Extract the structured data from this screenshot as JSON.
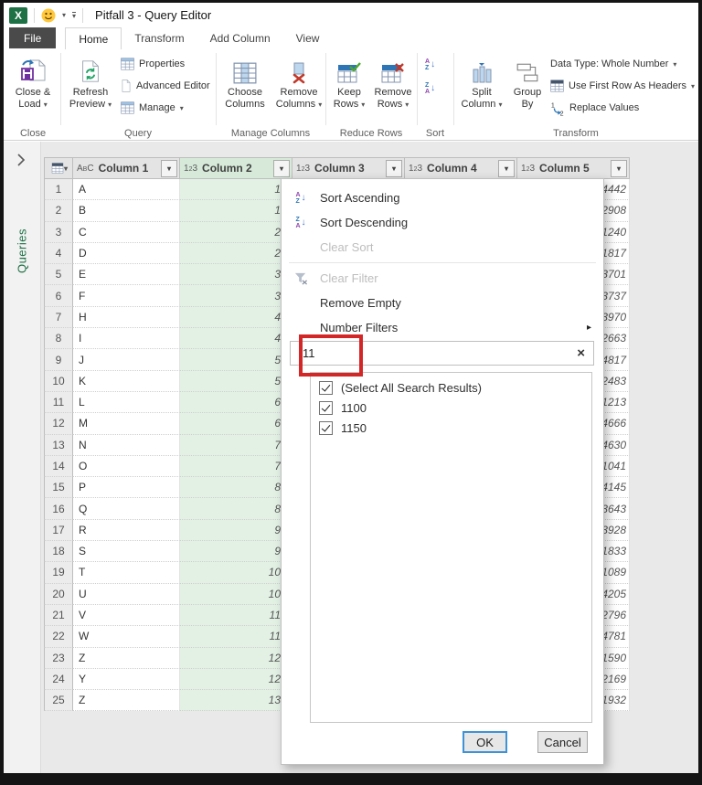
{
  "window": {
    "title": "Pitfall 3 - Query Editor"
  },
  "icons": {
    "dropdown": "▾",
    "submenu": "▸",
    "clear": "×",
    "chevron_right": ">",
    "sort_a": "A",
    "sort_z": "Z",
    "sort_arrow": "↓",
    "replace_one": "1",
    "replace_two": "2",
    "type_text": {
      "a": "A",
      "b": "B",
      "c": "C"
    },
    "type_num": {
      "a": "1",
      "b": "2",
      "c": "3"
    }
  },
  "tabs": {
    "file": "File",
    "home": "Home",
    "transform": "Transform",
    "add_column": "Add Column",
    "view": "View"
  },
  "ribbon": {
    "close_load_line1": "Close &",
    "close_load_line2": "Load",
    "refresh_line1": "Refresh",
    "refresh_line2": "Preview",
    "properties": "Properties",
    "advanced_editor": "Advanced Editor",
    "manage": "Manage",
    "choose_line1": "Choose",
    "choose_line2": "Columns",
    "remove_cols_line1": "Remove",
    "remove_cols_line2": "Columns",
    "keep_line1": "Keep",
    "keep_line2": "Rows",
    "remove_rows_line1": "Remove",
    "remove_rows_line2": "Rows",
    "split_line1": "Split",
    "split_line2": "Column",
    "group_line1": "Group",
    "group_line2": "By",
    "data_type": "Data Type: Whole Number",
    "first_row": "Use First Row As Headers",
    "replace_values": "Replace Values",
    "labels": {
      "close": "Close",
      "query": "Query",
      "manage_columns": "Manage Columns",
      "reduce_rows": "Reduce Rows",
      "sort": "Sort",
      "transform": "Transform"
    }
  },
  "sidebar": {
    "queries": "Queries"
  },
  "table": {
    "columns": [
      {
        "name": "Column 1",
        "type": "text"
      },
      {
        "name": "Column 2",
        "type": "number",
        "selected": true
      },
      {
        "name": "Column 3",
        "type": "number"
      },
      {
        "name": "Column 4",
        "type": "number"
      },
      {
        "name": "Column 5",
        "type": "number"
      }
    ],
    "rows": [
      {
        "n": "1",
        "letter": "A",
        "col2": "1",
        "col5": "4442"
      },
      {
        "n": "2",
        "letter": "B",
        "col2": "1",
        "col5": "2908"
      },
      {
        "n": "3",
        "letter": "C",
        "col2": "2",
        "col5": "1240"
      },
      {
        "n": "4",
        "letter": "D",
        "col2": "2",
        "col5": "1817"
      },
      {
        "n": "5",
        "letter": "E",
        "col2": "3",
        "col5": "3701"
      },
      {
        "n": "6",
        "letter": "F",
        "col2": "3",
        "col5": "3737"
      },
      {
        "n": "7",
        "letter": "H",
        "col2": "4",
        "col5": "3970"
      },
      {
        "n": "8",
        "letter": "I",
        "col2": "4",
        "col5": "2663"
      },
      {
        "n": "9",
        "letter": "J",
        "col2": "5",
        "col5": "4817"
      },
      {
        "n": "10",
        "letter": "K",
        "col2": "5",
        "col5": "2483"
      },
      {
        "n": "11",
        "letter": "L",
        "col2": "6",
        "col5": "1213"
      },
      {
        "n": "12",
        "letter": "M",
        "col2": "6",
        "col5": "4666"
      },
      {
        "n": "13",
        "letter": "N",
        "col2": "7",
        "col5": "4630"
      },
      {
        "n": "14",
        "letter": "O",
        "col2": "7",
        "col5": "1041"
      },
      {
        "n": "15",
        "letter": "P",
        "col2": "8",
        "col5": "4145"
      },
      {
        "n": "16",
        "letter": "Q",
        "col2": "8",
        "col5": "3643"
      },
      {
        "n": "17",
        "letter": "R",
        "col2": "9",
        "col5": "3928"
      },
      {
        "n": "18",
        "letter": "S",
        "col2": "9",
        "col5": "1833"
      },
      {
        "n": "19",
        "letter": "T",
        "col2": "10",
        "col5": "1089"
      },
      {
        "n": "20",
        "letter": "U",
        "col2": "10",
        "col5": "4205"
      },
      {
        "n": "21",
        "letter": "V",
        "col2": "11",
        "col5": "2796"
      },
      {
        "n": "22",
        "letter": "W",
        "col2": "11",
        "col5": "4781"
      },
      {
        "n": "23",
        "letter": "Z",
        "col2": "12",
        "col5": "1590"
      },
      {
        "n": "24",
        "letter": "Y",
        "col2": "12",
        "col5": "2169"
      },
      {
        "n": "25",
        "letter": "Z",
        "col2": "13",
        "col5": "1932"
      }
    ]
  },
  "filter_menu": {
    "items": [
      {
        "label": "Sort Ascending"
      },
      {
        "label": "Sort Descending"
      },
      {
        "label": "Clear Sort",
        "disabled": true
      },
      {
        "label": "Clear Filter",
        "disabled": true
      },
      {
        "label": "Remove Empty"
      },
      {
        "label": "Number Filters",
        "submenu": true
      }
    ],
    "search_value": "11",
    "checklist": [
      {
        "label": "(Select All Search Results)",
        "checked": true
      },
      {
        "label": "1100",
        "checked": true
      },
      {
        "label": "1150",
        "checked": true
      }
    ],
    "ok": "OK",
    "cancel": "Cancel"
  },
  "colors": {
    "excel_green": "#1e7145",
    "selected_column_header": "#d7ead9",
    "selected_column_cells": "#e3f1e5",
    "annotation_red": "#d32626",
    "ok_button_border": "#3e92d6",
    "file_tab_bg": "#4a4a4a"
  }
}
